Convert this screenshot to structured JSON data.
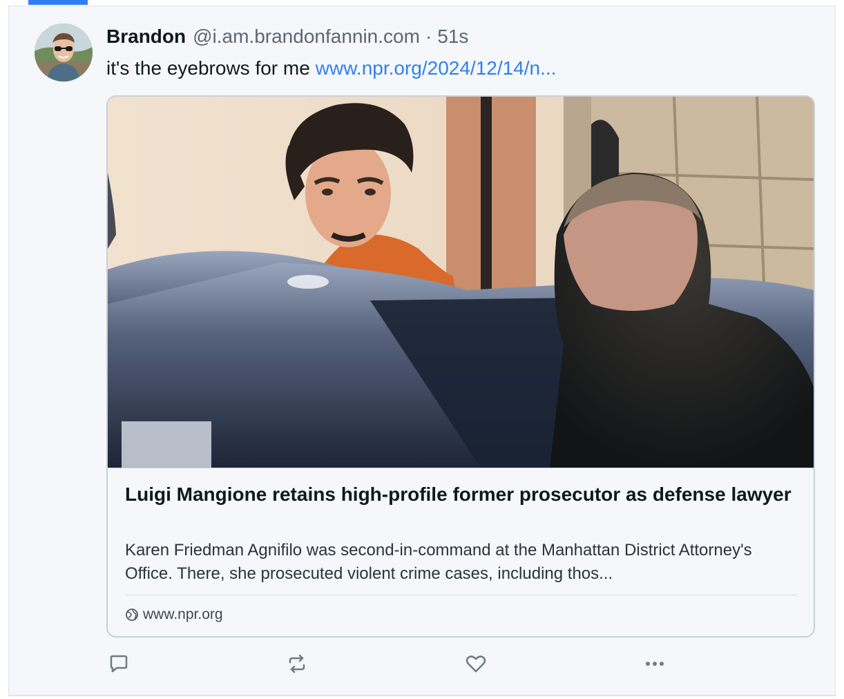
{
  "post": {
    "author_name": "Brandon",
    "author_handle": "@i.am.brandonfannin.com",
    "separator": "·",
    "timestamp": "51s",
    "text": "it's the eyebrows for me",
    "link_text": "www.npr.org/2024/12/14/n..."
  },
  "embed": {
    "title": "Luigi Mangione retains high-profile former prosecutor as defense lawyer",
    "description": "Karen Friedman Agnifilo was second-in-command at the Manhattan District Attorney's Office. There, she prosecuted violent crime cases, including thos...",
    "domain": "www.npr.org"
  },
  "actions": {
    "reply_icon": "reply-icon",
    "repost_icon": "repost-icon",
    "like_icon": "heart-icon",
    "more_icon": "more-icon"
  },
  "colors": {
    "accent": "#2f7ff0",
    "text": "#11181f",
    "muted": "#5b6673",
    "background": "#f5f7fa",
    "border": "#c9d0d8"
  }
}
